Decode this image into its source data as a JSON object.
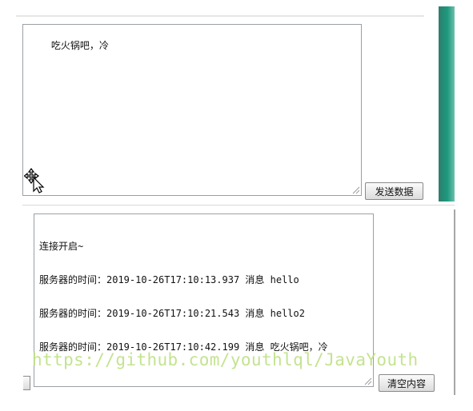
{
  "input": {
    "value": "吃火锅吧，冷"
  },
  "send_button": {
    "label": "发送数据"
  },
  "output": {
    "lines": [
      "连接开启~",
      "服务器的时间：2019-10-26T17:10:13.937 消息 hello",
      "服务器的时间：2019-10-26T17:10:21.543 消息 hello2",
      "服务器的时间：2019-10-26T17:10:42.199 消息 吃火锅吧，冷"
    ]
  },
  "clear_button": {
    "label": "清空内容"
  },
  "watermark": {
    "text": "https://github.com/youthlql/JavaYouth"
  },
  "colors": {
    "accent_panel": "#1c9a7e",
    "watermark": "#b9df7c"
  },
  "icons": {
    "cursor": "move-cursor-icon",
    "grip": "resize-grip-icon"
  }
}
